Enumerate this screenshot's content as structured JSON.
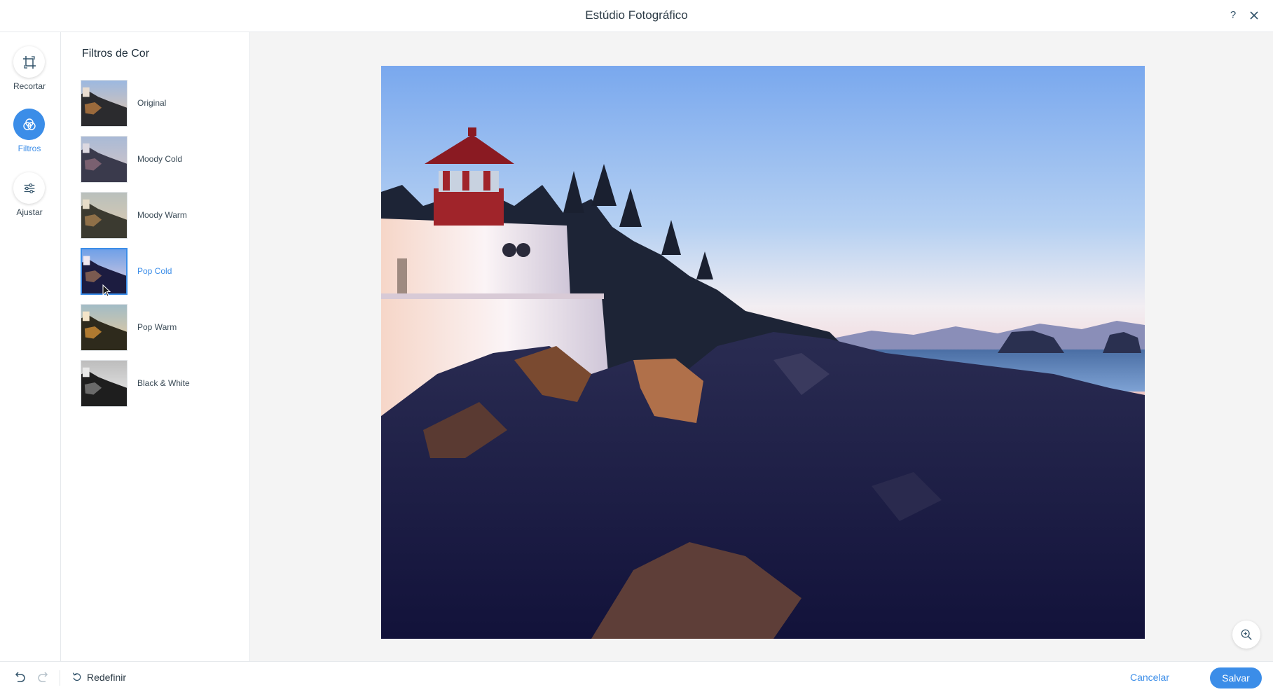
{
  "header": {
    "title": "Estúdio Fotográfico",
    "help_label": "?"
  },
  "toolbar": {
    "items": [
      {
        "label": "Recortar",
        "icon": "crop-icon",
        "active": false
      },
      {
        "label": "Filtros",
        "icon": "filters-icon",
        "active": true
      },
      {
        "label": "Ajustar",
        "icon": "sliders-icon",
        "active": false
      }
    ]
  },
  "filters_panel": {
    "title": "Filtros de Cor",
    "items": [
      {
        "name": "Original",
        "selected": false
      },
      {
        "name": "Moody Cold",
        "selected": false
      },
      {
        "name": "Moody Warm",
        "selected": false
      },
      {
        "name": "Pop Cold",
        "selected": true
      },
      {
        "name": "Pop Warm",
        "selected": false
      },
      {
        "name": "Black & White",
        "selected": false
      }
    ]
  },
  "footer": {
    "reset_label": "Redefinir",
    "cancel_label": "Cancelar",
    "save_label": "Salvar"
  },
  "colors": {
    "accent": "#3b8de8",
    "border": "#e6e9ec",
    "canvas_bg": "#f4f4f4"
  }
}
